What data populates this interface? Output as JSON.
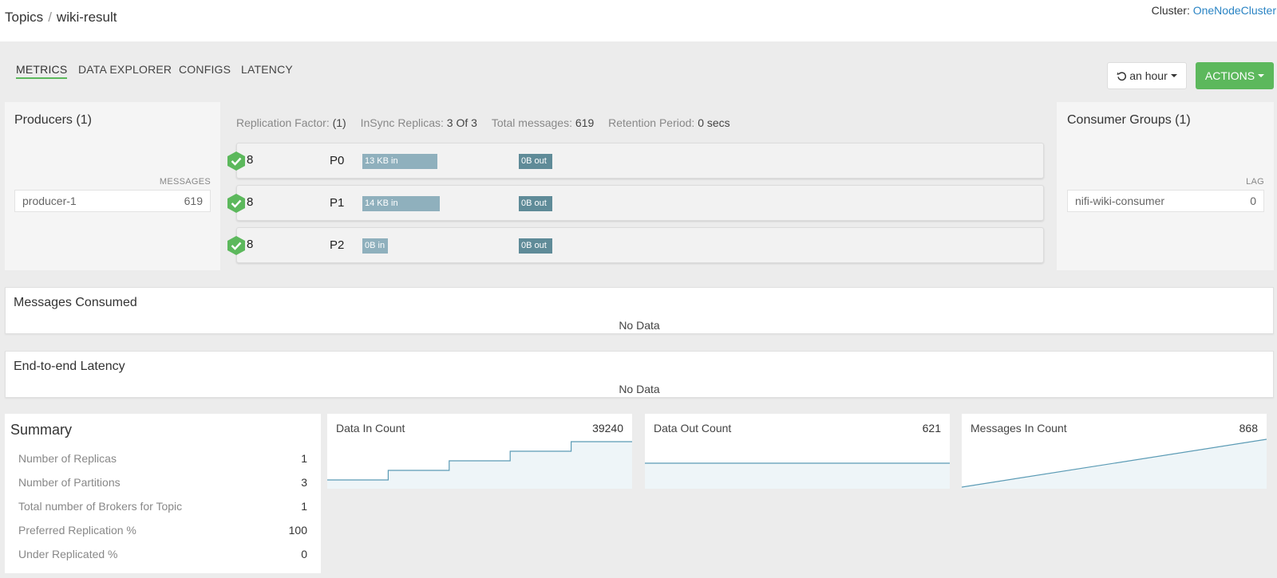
{
  "breadcrumb": {
    "parent": "Topics",
    "separator": "/",
    "current": "wiki-result"
  },
  "cluster": {
    "label": "Cluster:",
    "name": "OneNodeCluster"
  },
  "tabs": [
    {
      "label": "METRICS",
      "active": true
    },
    {
      "label": "DATA EXPLORER",
      "active": false
    },
    {
      "label": "CONFIGS",
      "active": false
    },
    {
      "label": "LATENCY",
      "active": false
    }
  ],
  "time_button": {
    "label": "an hour"
  },
  "actions_button": {
    "label": "ACTIONS"
  },
  "producers": {
    "title": "Producers (1)",
    "column_label": "MESSAGES",
    "items": [
      {
        "name": "producer-1",
        "value": "619"
      }
    ]
  },
  "topic_stats": {
    "replication_factor_label": "Replication Factor:",
    "replication_factor": "(1)",
    "insync_label": "InSync Replicas:",
    "insync": "3 Of 3",
    "total_messages_label": "Total messages:",
    "total_messages": "619",
    "retention_label": "Retention Period:",
    "retention": "0 secs"
  },
  "partitions": [
    {
      "replicas": "8",
      "name": "P0",
      "in_label": "13 KB in",
      "in_fraction": 0.41,
      "out_label": "0B out"
    },
    {
      "replicas": "8",
      "name": "P1",
      "in_label": "14 KB in",
      "in_fraction": 0.42,
      "out_label": "0B out"
    },
    {
      "replicas": "8",
      "name": "P2",
      "in_label": "0B in",
      "in_fraction": 0.14,
      "out_label": "0B out"
    }
  ],
  "consumers": {
    "title": "Consumer Groups (1)",
    "column_label": "LAG",
    "items": [
      {
        "name": "nifi-wiki-consumer",
        "value": "0"
      }
    ]
  },
  "messages_consumed": {
    "title": "Messages Consumed",
    "empty": "No Data"
  },
  "e2e_latency": {
    "title": "End-to-end Latency",
    "empty": "No Data"
  },
  "summary": {
    "title": "Summary",
    "rows": [
      {
        "label": "Number of Replicas",
        "value": "1"
      },
      {
        "label": "Number of Partitions",
        "value": "3"
      },
      {
        "label": "Total number of Brokers for Topic",
        "value": "1"
      },
      {
        "label": "Preferred Replication %",
        "value": "100"
      },
      {
        "label": "Under Replicated %",
        "value": "0"
      }
    ]
  },
  "metrics": [
    {
      "title": "Data In Count",
      "value": "39240",
      "shape": "steps",
      "series": [
        0.15,
        0.35,
        0.55,
        0.75,
        0.95
      ]
    },
    {
      "title": "Data Out Count",
      "value": "621",
      "shape": "flat",
      "series": [
        0.5
      ]
    },
    {
      "title": "Messages In Count",
      "value": "868",
      "shape": "ramp",
      "series": [
        0.0,
        1.0
      ]
    }
  ],
  "colors": {
    "accent_green": "#5cb85c",
    "link_blue": "#2a84c4",
    "bar_in": "#8fb0bd",
    "bar_out": "#5f8b98",
    "chart_line": "#5b9bb5",
    "chart_fill": "#eef5f8"
  },
  "icons": {
    "shield": "shield-check-icon",
    "refresh": "refresh-icon"
  }
}
